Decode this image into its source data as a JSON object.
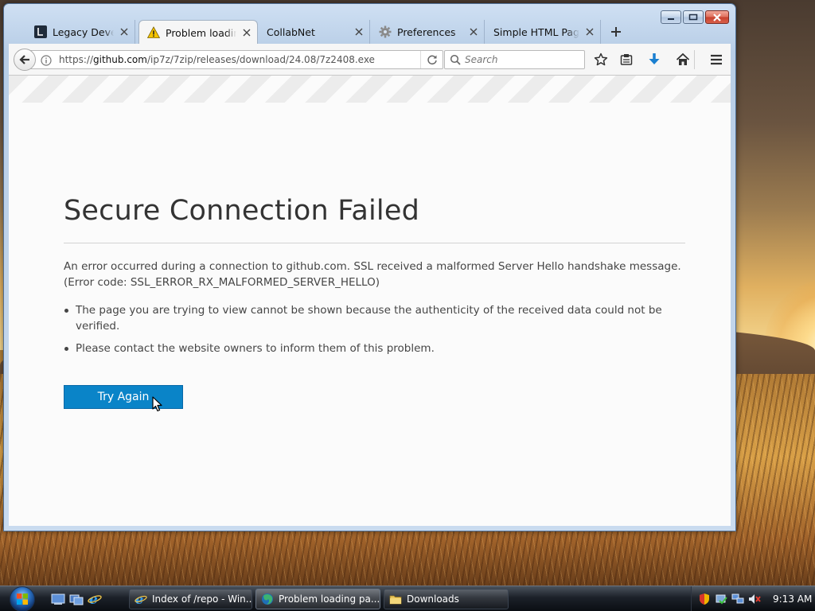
{
  "tabs": [
    {
      "title": "Legacy Develop",
      "icon": "legacy-site-icon"
    },
    {
      "title": "Problem loadin",
      "icon": "warning-icon"
    },
    {
      "title": "CollabNet",
      "icon": ""
    },
    {
      "title": "Preferences",
      "icon": "gear-icon"
    },
    {
      "title": "Simple HTML Page",
      "icon": ""
    }
  ],
  "navbar": {
    "url_prefix": "https://",
    "url_host": "github.com",
    "url_path": "/ip7z/7zip/releases/download/24.08/7z2408.exe",
    "search_placeholder": "Search"
  },
  "error": {
    "title": "Secure Connection Failed",
    "description": "An error occurred during a connection to github.com. SSL received a malformed Server Hello handshake message. (Error code: SSL_ERROR_RX_MALFORMED_SERVER_HELLO)",
    "bullets": [
      "The page you are trying to view cannot be shown because the authenticity of the received data could not be verified.",
      "Please contact the website owners to inform them of this problem."
    ],
    "button_label": "Try Again"
  },
  "taskbar": {
    "tasks": [
      {
        "label": "Index of /repo - Win...",
        "icon": "ie-icon"
      },
      {
        "label": "Problem loading pa...",
        "icon": "firefox-icon"
      },
      {
        "label": "Downloads",
        "icon": "folder-icon"
      }
    ],
    "clock": "9:13 AM"
  },
  "colors": {
    "accent_button": "#0a84c8",
    "title_text": "#333333",
    "body_text": "#454545"
  }
}
